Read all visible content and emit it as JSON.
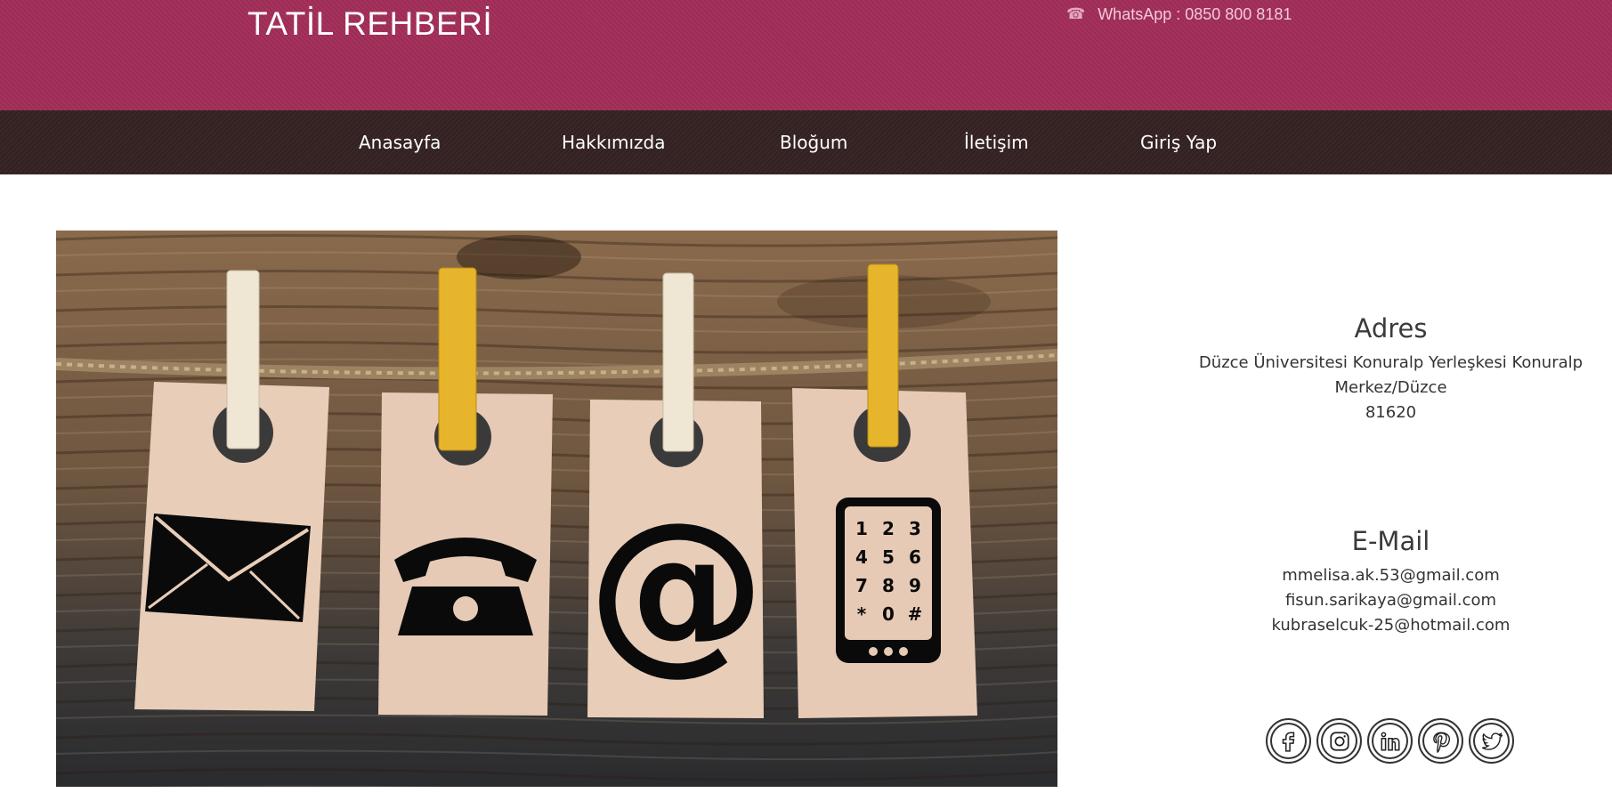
{
  "header": {
    "brand": "TATİL REHBERİ",
    "whatsapp": "WhatsApp : 0850 800 8181",
    "phone_icon": "phone-icon",
    "brand_color": "#a12d58"
  },
  "nav": {
    "background": "#352222",
    "items": [
      {
        "label": "Anasayfa"
      },
      {
        "label": "Hakkımızda"
      },
      {
        "label": "Bloğum"
      },
      {
        "label": "İletişim"
      },
      {
        "label": "Giriş Yap"
      }
    ]
  },
  "hero": {
    "icons": [
      "envelope-icon",
      "telephone-icon",
      "at-sign-icon",
      "mobile-phone-icon"
    ],
    "keypad": [
      "1",
      "2",
      "3",
      "4",
      "5",
      "6",
      "7",
      "8",
      "9",
      "*",
      "0",
      "#"
    ],
    "at_symbol": "@"
  },
  "address": {
    "title": "Adres",
    "lines": [
      "Düzce Üniversitesi Konuralp Yerleşkesi Konuralp",
      "Merkez/Düzce",
      "81620"
    ]
  },
  "email": {
    "title": "E-Mail",
    "lines": [
      "mmelisa.ak.53@gmail.com",
      "fisun.sarikaya@gmail.com",
      "kubraselcuk-25@hotmail.com"
    ]
  },
  "socials": [
    "facebook-icon",
    "instagram-icon",
    "linkedin-icon",
    "pinterest-icon",
    "twitter-icon"
  ]
}
